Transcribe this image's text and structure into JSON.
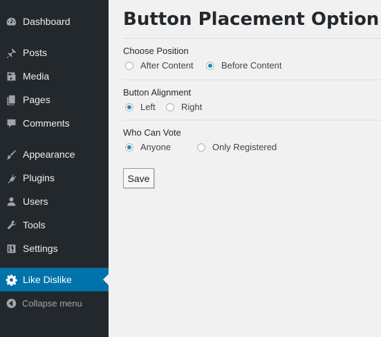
{
  "sidebar": {
    "items": [
      {
        "label": "Dashboard",
        "icon": "dashboard-icon"
      },
      {
        "label": "Posts",
        "icon": "pin-icon"
      },
      {
        "label": "Media",
        "icon": "media-icon"
      },
      {
        "label": "Pages",
        "icon": "pages-icon"
      },
      {
        "label": "Comments",
        "icon": "comment-icon"
      },
      {
        "label": "Appearance",
        "icon": "brush-icon"
      },
      {
        "label": "Plugins",
        "icon": "plugin-icon"
      },
      {
        "label": "Users",
        "icon": "user-icon"
      },
      {
        "label": "Tools",
        "icon": "wrench-icon"
      },
      {
        "label": "Settings",
        "icon": "settings-icon"
      },
      {
        "label": "Like Dislike",
        "icon": "gear-icon",
        "current": true
      }
    ],
    "collapse_label": "Collapse menu"
  },
  "main": {
    "title": "Button Placement Option",
    "sections": [
      {
        "label": "Choose Position",
        "options": [
          {
            "label": "After Content",
            "checked": false
          },
          {
            "label": "Before Content",
            "checked": true
          }
        ]
      },
      {
        "label": "Button Alignment",
        "options": [
          {
            "label": "Left",
            "checked": true
          },
          {
            "label": "Right",
            "checked": false
          }
        ]
      },
      {
        "label": "Who Can Vote",
        "options": [
          {
            "label": "Anyone",
            "checked": true
          },
          {
            "label": "Only Registered",
            "checked": false
          }
        ]
      }
    ],
    "save_label": "Save"
  },
  "colors": {
    "sidebar_bg": "#23282d",
    "current_bg": "#0073aa",
    "content_bg": "#f1f1f1",
    "radio_checked": "#1e8cbe"
  }
}
